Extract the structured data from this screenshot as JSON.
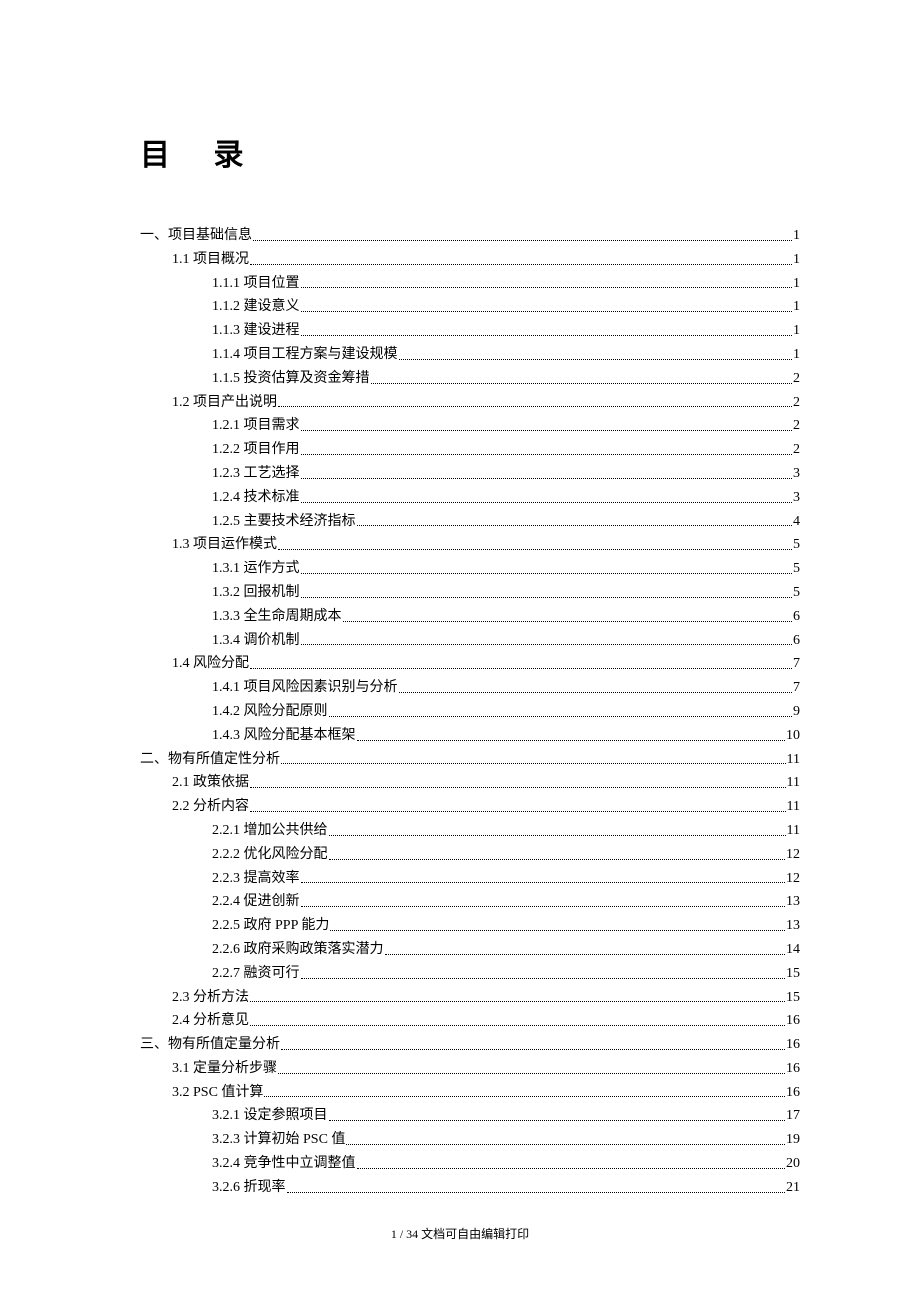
{
  "title": "目 录",
  "footer": "1 / 34 文档可自由编辑打印",
  "toc": [
    {
      "label": "一、项目基础信息",
      "page": "1",
      "indent": 0
    },
    {
      "label": "1.1  项目概况",
      "page": "1",
      "indent": 1
    },
    {
      "label": "1.1.1 项目位置",
      "page": "1",
      "indent": 2
    },
    {
      "label": "1.1.2 建设意义",
      "page": "1",
      "indent": 2
    },
    {
      "label": "1.1.3 建设进程",
      "page": "1",
      "indent": 2
    },
    {
      "label": "1.1.4 项目工程方案与建设规模",
      "page": "1",
      "indent": 2
    },
    {
      "label": "1.1.5 投资估算及资金筹措",
      "page": "2",
      "indent": 2
    },
    {
      "label": "1.2 项目产出说明",
      "page": "2",
      "indent": 1
    },
    {
      "label": "1.2.1 项目需求",
      "page": "2",
      "indent": 2
    },
    {
      "label": "1.2.2 项目作用",
      "page": "2",
      "indent": 2
    },
    {
      "label": "1.2.3 工艺选择",
      "page": "3",
      "indent": 2
    },
    {
      "label": "1.2.4 技术标准",
      "page": "3",
      "indent": 2
    },
    {
      "label": "1.2.5 主要技术经济指标",
      "page": "4",
      "indent": 2
    },
    {
      "label": "1.3  项目运作模式",
      "page": "5",
      "indent": 1
    },
    {
      "label": "1.3.1 运作方式",
      "page": "5",
      "indent": 2
    },
    {
      "label": "1.3.2 回报机制",
      "page": "5",
      "indent": 2
    },
    {
      "label": "1.3.3 全生命周期成本",
      "page": "6",
      "indent": 2
    },
    {
      "label": "1.3.4 调价机制",
      "page": "6",
      "indent": 2
    },
    {
      "label": "1.4  风险分配",
      "page": "7",
      "indent": 1
    },
    {
      "label": "1.4.1 项目风险因素识别与分析",
      "page": "7",
      "indent": 2
    },
    {
      "label": "1.4.2 风险分配原则",
      "page": "9",
      "indent": 2
    },
    {
      "label": "1.4.3 风险分配基本框架",
      "page": "10",
      "indent": 2
    },
    {
      "label": "二、物有所值定性分析",
      "page": "11",
      "indent": 0
    },
    {
      "label": "2.1 政策依据",
      "page": "11",
      "indent": 1
    },
    {
      "label": "2.2 分析内容",
      "page": "11",
      "indent": 1
    },
    {
      "label": "2.2.1 增加公共供给",
      "page": "11",
      "indent": 2
    },
    {
      "label": "2.2.2 优化风险分配",
      "page": "12",
      "indent": 2
    },
    {
      "label": "2.2.3 提高效率",
      "page": "12",
      "indent": 2
    },
    {
      "label": "2.2.4 促进创新",
      "page": "13",
      "indent": 2
    },
    {
      "label": "2.2.5 政府 PPP 能力",
      "page": "13",
      "indent": 2
    },
    {
      "label": "2.2.6 政府采购政策落实潜力",
      "page": "14",
      "indent": 2
    },
    {
      "label": "2.2.7 融资可行",
      "page": "15",
      "indent": 2
    },
    {
      "label": "2.3 分析方法",
      "page": "15",
      "indent": 1
    },
    {
      "label": "2.4 分析意见",
      "page": "16",
      "indent": 1
    },
    {
      "label": "三、物有所值定量分析",
      "page": "16",
      "indent": 0
    },
    {
      "label": "3.1 定量分析步骤",
      "page": "16",
      "indent": 1
    },
    {
      "label": "3.2 PSC 值计算",
      "page": "16",
      "indent": 1
    },
    {
      "label": "3.2.1 设定参照项目",
      "page": "17",
      "indent": 2
    },
    {
      "label": "3.2.3 计算初始 PSC 值",
      "page": "19",
      "indent": 2
    },
    {
      "label": "3.2.4 竞争性中立调整值",
      "page": "20",
      "indent": 2
    },
    {
      "label": "3.2.6 折现率",
      "page": "21",
      "indent": 2
    }
  ]
}
